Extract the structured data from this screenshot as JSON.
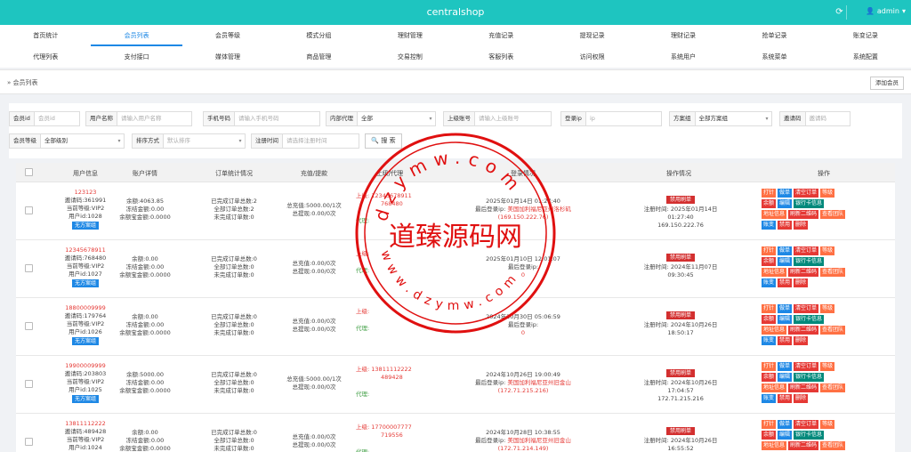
{
  "app": {
    "title": "centralshop",
    "user": "admin"
  },
  "nav": {
    "row1": [
      "首页统计",
      "会员列表",
      "会员等级",
      "模式分组",
      "理财管理",
      "充值记录",
      "提现记录",
      "理财记录",
      "抢单记录",
      "账变记录"
    ],
    "row2": [
      "代理列表",
      "支付接口",
      "媒体管理",
      "商品管理",
      "交易控制",
      "客服列表",
      "访问权限",
      "系统用户",
      "系统菜单",
      "系统配置"
    ],
    "active": "会员列表"
  },
  "breadcrumb": {
    "text": "会员列表",
    "add_button": "添加会员"
  },
  "filters": {
    "member_id": {
      "label": "会员id",
      "placeholder": "会员id"
    },
    "username": {
      "label": "用户名称",
      "placeholder": "请输入用户名称"
    },
    "phone": {
      "label": "手机号码",
      "placeholder": "请输入手机号码"
    },
    "agent": {
      "label": "内部代理",
      "value": "全部"
    },
    "superior": {
      "label": "上级账号",
      "placeholder": "请输入上级账号"
    },
    "login_ip": {
      "label": "登录ip",
      "placeholder": "ip"
    },
    "scheme": {
      "label": "方案组",
      "value": "全部方案组"
    },
    "invite": {
      "label": "邀请码",
      "placeholder": "邀请码"
    },
    "level": {
      "label": "会员等级",
      "value": "全部级别"
    },
    "sort": {
      "label": "排序方式",
      "placeholder": "默认排序"
    },
    "reg_time": {
      "label": "注册时间",
      "placeholder": "请选择注册时间"
    },
    "search_button": "搜 索"
  },
  "table": {
    "headers": [
      "用户信息",
      "账户详情",
      "订单统计情况",
      "充值/提款",
      "上级/代理",
      "登录情况",
      "操作情况",
      "操作"
    ],
    "rows": [
      {
        "user": "123123",
        "invite": "邀请码:361991",
        "level": "当前等级:VIP2",
        "uid": "用户id:1028",
        "group": "无方案组",
        "balance": "余额:4063.85",
        "frozen": "冻结金额:0.00",
        "yeb": "余额宝金额:0.0000",
        "done": "已完成订单总数:2",
        "all": "全部订单总数:2",
        "undone": "未完成订单数:0",
        "recharge": "总充值:5000.00/1次",
        "withdraw": "总提现:0.00/0次",
        "sup_label": "上级:",
        "sup_val": "12345678911",
        "sup_code": "768480",
        "agent_label": "代理:",
        "login_time": "2025年01月14日 01:27:40",
        "login_ip_label": "最后登录ip:",
        "login_loc": "美国加利福尼亚州洛杉矶",
        "login_ip": "(169.150.222.76)",
        "status": "禁用刷单",
        "reg_time": "注册时间: 2025年01月14日 01:27:40",
        "reg_ip": "169.150.222.76"
      },
      {
        "user": "12345678911",
        "invite": "邀请码:768480",
        "level": "当前等级:VIP2",
        "uid": "用户id:1027",
        "group": "无方案组",
        "balance": "余额:0.00",
        "frozen": "冻结金额:0.00",
        "yeb": "余额宝金额:0.0000",
        "done": "已完成订单总数:0",
        "all": "全部订单总数:0",
        "undone": "未完成订单数:0",
        "recharge": "总充值:0.00/0次",
        "withdraw": "总提现:0.00/0次",
        "sup_label": "上级:",
        "sup_val": "",
        "sup_code": "",
        "agent_label": "代理:",
        "login_time": "2025年01月10日 12:01:07",
        "login_ip_label": "最后登录ip:",
        "login_loc": "",
        "login_ip": "0",
        "status": "禁用刷单",
        "reg_time": "注册时间: 2024年11月07日 09:30:45",
        "reg_ip": ""
      },
      {
        "user": "18800009999",
        "invite": "邀请码:179764",
        "level": "当前等级:VIP2",
        "uid": "用户id:1026",
        "group": "无方案组",
        "balance": "余额:0.00",
        "frozen": "冻结金额:0.00",
        "yeb": "余额宝金额:0.0000",
        "done": "已完成订单总数:0",
        "all": "全部订单总数:0",
        "undone": "未完成订单数:0",
        "recharge": "总充值:0.00/0次",
        "withdraw": "总提现:0.00/0次",
        "sup_label": "上级:",
        "sup_val": "",
        "sup_code": "",
        "agent_label": "代理:",
        "login_time": "2024年10月30日 05:06:59",
        "login_ip_label": "最后登录ip:",
        "login_loc": "",
        "login_ip": "0",
        "status": "禁用刷单",
        "reg_time": "注册时间: 2024年10月26日 18:50:17",
        "reg_ip": ""
      },
      {
        "user": "19900009999",
        "invite": "邀请码:203803",
        "level": "当前等级:VIP2",
        "uid": "用户id:1025",
        "group": "无方案组",
        "balance": "余额:5000.00",
        "frozen": "冻结金额:0.00",
        "yeb": "余额宝金额:0.0000",
        "done": "已完成订单总数:0",
        "all": "全部订单总数:0",
        "undone": "未完成订单数:0",
        "recharge": "总充值:5000.00/1次",
        "withdraw": "总提现:0.00/0次",
        "sup_label": "上级:",
        "sup_val": "13811112222",
        "sup_code": "489428",
        "agent_label": "代理:",
        "login_time": "2024年10月26日 19:00:49",
        "login_ip_label": "最后登录ip:",
        "login_loc": "美国加利福尼亚州旧金山",
        "login_ip": "(172.71.215.216)",
        "status": "禁用刷单",
        "reg_time": "注册时间: 2024年10月26日 17:04:57",
        "reg_ip": "172.71.215.216"
      },
      {
        "user": "13811112222",
        "invite": "邀请码:489428",
        "level": "当前等级:VIP2",
        "uid": "用户id:1024",
        "group": "无方案组",
        "balance": "余额:0.00",
        "frozen": "冻结金额:0.00",
        "yeb": "余额宝金额:0.0000",
        "done": "已完成订单总数:0",
        "all": "全部订单总数:0",
        "undone": "未完成订单数:0",
        "recharge": "总充值:0.00/0次",
        "withdraw": "总提现:0.00/0次",
        "sup_label": "上级:",
        "sup_val": "17700007777",
        "sup_code": "719556",
        "agent_label": "代理:",
        "login_time": "2024年10月28日 10:38:55",
        "login_ip_label": "最后登录ip:",
        "login_loc": "美国加利福尼亚州旧金山",
        "login_ip": "(172.71.214.149)",
        "status": "禁用刷单",
        "reg_time": "注册时间: 2024年10月26日 16:55:52",
        "reg_ip": "172.71.214.149"
      }
    ],
    "action_labels": [
      "打针",
      "做单",
      "清空订单",
      "等级",
      "余额",
      "编辑",
      "银行卡信息",
      "地址信息",
      "刷新二维码",
      "查看团队",
      "账变",
      "禁用",
      "删除"
    ]
  },
  "watermark": {
    "center_text": "道臻源码网",
    "ring_top": "dzymw.com",
    "ring_bottom": "www.dzymw.com"
  },
  "colors": {
    "topbar": "#1ec5c0",
    "accent": "#1e88e5",
    "danger": "#e53935",
    "watermark": "#e01010"
  }
}
